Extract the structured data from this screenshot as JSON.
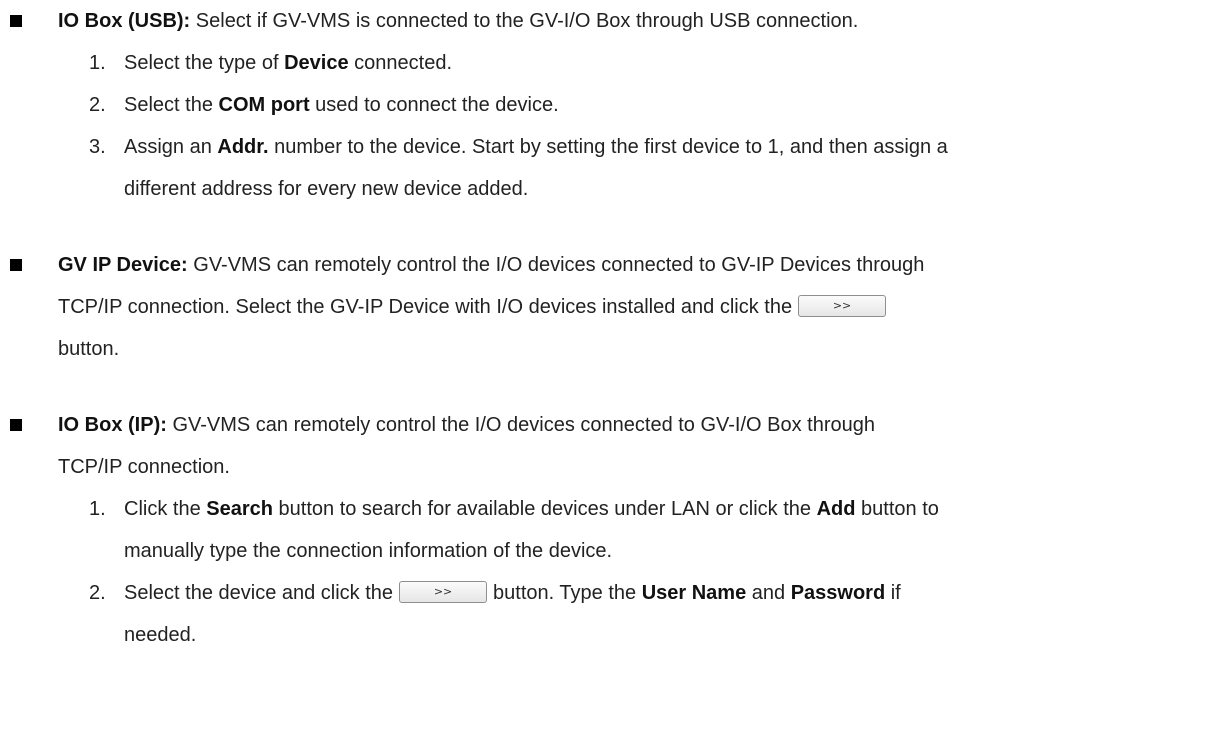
{
  "sections": {
    "usb": {
      "title": "IO Box (USB):",
      "desc": "Select if GV-VMS is connected to the GV-I/O Box through USB connection.",
      "steps": [
        {
          "num": "1.",
          "pre": "Select the type of ",
          "bold": "Device",
          "post": " connected."
        },
        {
          "num": "2.",
          "pre": "Select the ",
          "bold": "COM port",
          "post": " used to connect the device."
        },
        {
          "num": "3.",
          "pre": "Assign an ",
          "bold": "Addr.",
          "post": " number to the device. Start by setting the first device to 1, and then assign a",
          "cont": "different address for every new device added."
        }
      ]
    },
    "gvip": {
      "title": "GV IP Device:",
      "desc1": "GV-VMS can remotely control the I/O devices connected to GV-IP Devices through",
      "desc2": "TCP/IP connection. Select the GV-IP Device with I/O devices installed and click the",
      "desc3": "button.",
      "button_label": ">>"
    },
    "ip": {
      "title": "IO Box (IP):",
      "desc1": "GV-VMS can remotely control the I/O devices connected to GV-I/O Box through",
      "desc2": "TCP/IP connection.",
      "step1": {
        "num": "1.",
        "pre": "Click the ",
        "bold1": "Search",
        "mid": " button to search for available devices under LAN or click the ",
        "bold2": "Add",
        "post": " button to",
        "cont": "manually type the connection information of the device."
      },
      "step2": {
        "num": "2.",
        "pre": "Select the device and click the",
        "button_label": ">>",
        "mid": "button. Type the ",
        "bold1": "User Name",
        "and": " and ",
        "bold2": "Password",
        "post": " if",
        "cont": "needed."
      }
    }
  }
}
